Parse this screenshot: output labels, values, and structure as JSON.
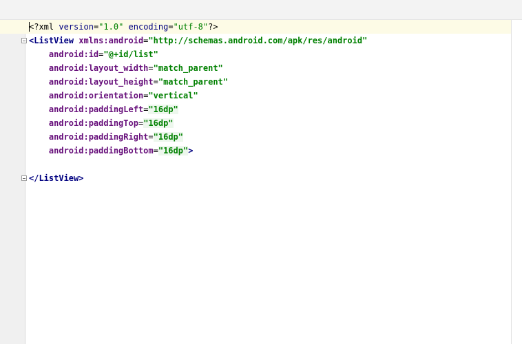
{
  "editor": {
    "lines": [
      {
        "p1": "<?xml ",
        "a1": "version",
        "eq1": "=",
        "v1": "\"1.0\"",
        "s1": " ",
        "a2": "encoding",
        "eq2": "=",
        "v2": "\"utf-8\"",
        "e1": "?>"
      },
      {
        "t1": "<ListView ",
        "a1": "xmlns:android",
        "eq1": "=",
        "v1": "\"http://schemas.android.com/apk/res/android\""
      },
      {
        "indent": "    ",
        "a1": "android:id",
        "eq1": "=",
        "v1": "\"@+id/list\""
      },
      {
        "indent": "    ",
        "a1": "android:layout_width",
        "eq1": "=",
        "v1": "\"match_parent\""
      },
      {
        "indent": "    ",
        "a1": "android:layout_height",
        "eq1": "=",
        "v1": "\"match_parent\""
      },
      {
        "indent": "    ",
        "a1": "android:orientation",
        "eq1": "=",
        "v1": "\"vertical\""
      },
      {
        "indent": "    ",
        "a1": "android:paddingLeft",
        "eq1": "=",
        "v1": "\"16dp\""
      },
      {
        "indent": "    ",
        "a1": "android:paddingTop",
        "eq1": "=",
        "v1": "\"16dp\""
      },
      {
        "indent": "    ",
        "a1": "android:paddingRight",
        "eq1": "=",
        "v1": "\"16dp\""
      },
      {
        "indent": "    ",
        "a1": "android:paddingBottom",
        "eq1": "=",
        "v1": "\"16dp\"",
        "e1": ">"
      },
      {
        "blank": ""
      },
      {
        "t1": "</ListView>"
      }
    ]
  }
}
